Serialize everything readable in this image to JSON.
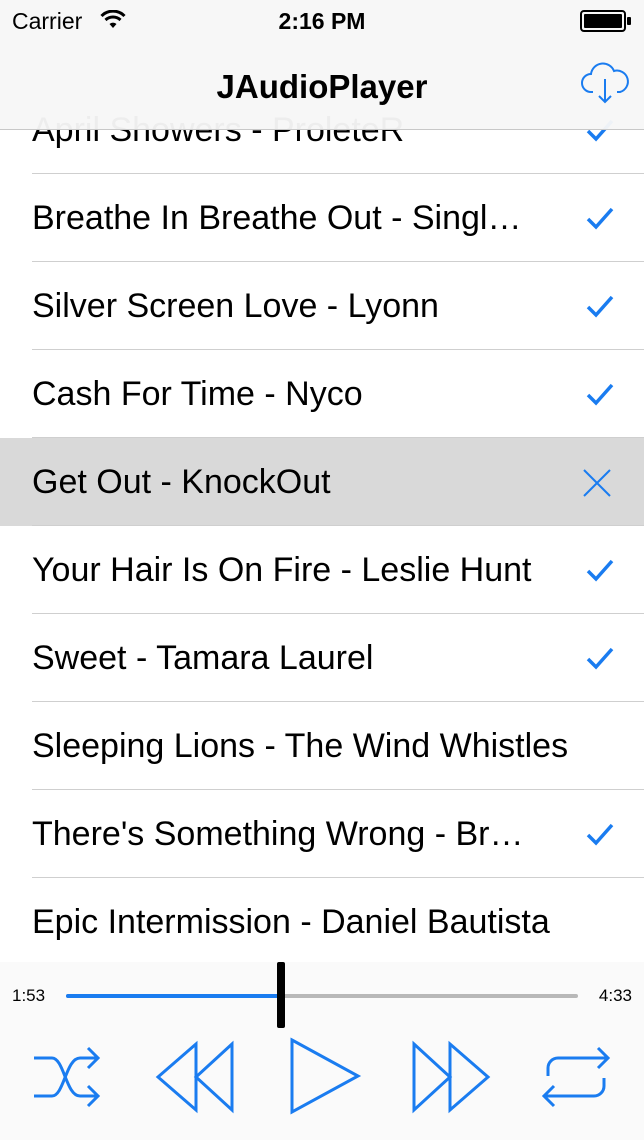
{
  "status_bar": {
    "carrier": "Carrier",
    "time": "2:16 PM"
  },
  "nav": {
    "title": "JAudioPlayer",
    "right_icon": "cloud-download-icon"
  },
  "tracks": [
    {
      "label": "April Showers - ProleteR",
      "state": "checked"
    },
    {
      "label": "Breathe In Breathe Out - Singl…",
      "state": "checked"
    },
    {
      "label": "Silver Screen Love - Lyonn",
      "state": "checked"
    },
    {
      "label": "Cash For Time - Nyco",
      "state": "checked"
    },
    {
      "label": "Get Out - KnockOut",
      "state": "selected"
    },
    {
      "label": "Your Hair Is On Fire - Leslie Hunt",
      "state": "checked"
    },
    {
      "label": "Sweet - Tamara Laurel",
      "state": "checked"
    },
    {
      "label": "Sleeping Lions - The Wind Whistles",
      "state": "none"
    },
    {
      "label": "There's Something Wrong - Br…",
      "state": "checked"
    },
    {
      "label": "Epic Intermission - Daniel Bautista",
      "state": "none"
    }
  ],
  "player": {
    "elapsed": "1:53",
    "remaining": "4:33",
    "progress_fraction": 0.42,
    "controls": [
      "shuffle-icon",
      "rewind-icon",
      "play-icon",
      "fast-forward-icon",
      "repeat-icon"
    ]
  },
  "colors": {
    "accent": "#1a7cf0",
    "selected_row": "#d9d9d9"
  }
}
